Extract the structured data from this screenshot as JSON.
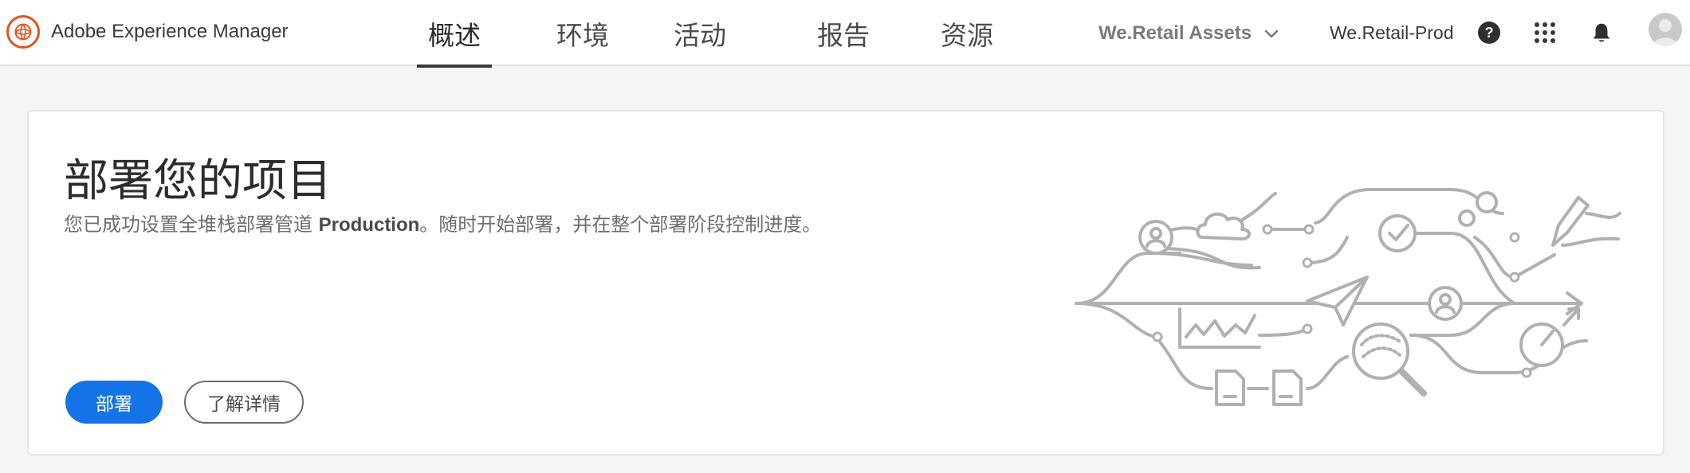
{
  "header": {
    "brand_name": "Adobe Experience Manager",
    "tabs": [
      {
        "label": "概述",
        "active": true
      },
      {
        "label": "环境",
        "active": false
      },
      {
        "label": "活动",
        "active": false
      },
      {
        "label": "报告",
        "active": false
      },
      {
        "label": "资源",
        "active": false
      }
    ],
    "org_switcher": "We.Retail Assets",
    "program": "We.Retail-Prod",
    "icons": [
      "help-icon",
      "app-grid-icon",
      "bell-icon",
      "avatar"
    ],
    "brand_color": "#e1541f"
  },
  "card": {
    "title": "部署您的项目",
    "description_prefix": "您已成功设置全堆栈部署管道 ",
    "description_bold": "Production",
    "description_suffix": "。随时开始部署，并在整个部署阶段控制进度。",
    "primary_button": "部署",
    "secondary_button": "了解详情",
    "primary_color": "#1473e6"
  }
}
